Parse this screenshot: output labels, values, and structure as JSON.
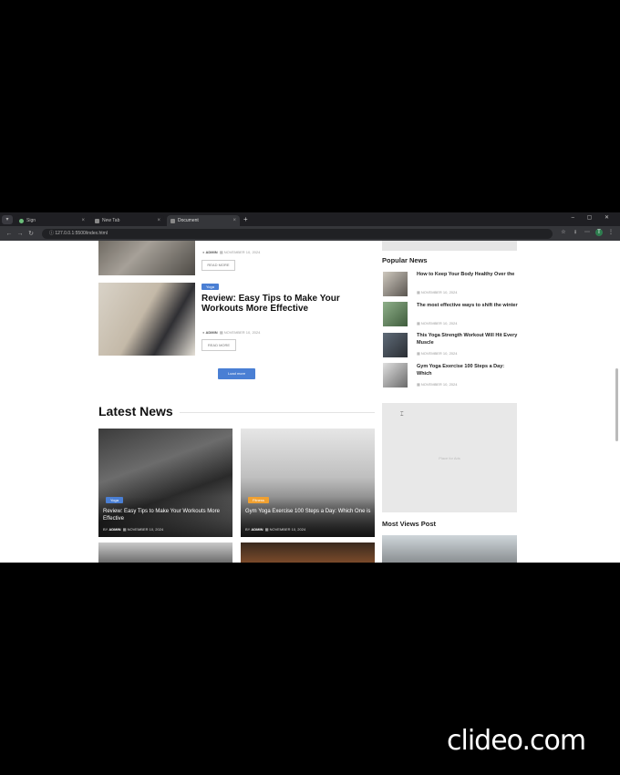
{
  "browser": {
    "tabs": [
      {
        "label": "Sign",
        "active": false
      },
      {
        "label": "New Tab",
        "active": false
      },
      {
        "label": "Document",
        "active": true
      }
    ],
    "url": "127.0.0.1:5500/index.html",
    "new_tab": "+",
    "window_controls": "– ▢ ✕",
    "menu": "▾",
    "nav_back": "←",
    "nav_forward": "→",
    "nav_reload": "↻",
    "url_icon": "ⓘ",
    "star_icon": "☆",
    "download_icon": "⭳",
    "extensions_icon": "⋯",
    "profile_initial": "T",
    "more_icon": "⋮",
    "tab_close": "×"
  },
  "featured": [
    {
      "category": "",
      "title": "",
      "author": "ADMIN",
      "date": "NOVEMBER 10, 2024",
      "button": "READ MORE"
    },
    {
      "category": "Yoga",
      "title": "Review: Easy Tips to Make Your Workouts More Effective",
      "author": "ADMIN",
      "date": "NOVEMBER 10, 2024",
      "button": "READ MORE"
    }
  ],
  "load_more": "Load more",
  "latest_news": {
    "heading": "Latest News",
    "cards": [
      {
        "category": "Yoga",
        "title": "Review: Easy Tips to Make Your Workouts More Effective",
        "by": "BY",
        "author": "ADMIN",
        "date": "NOVEMBER 10, 2024"
      },
      {
        "category": "Fitness",
        "title": "Gym Yoga Exercise 100 Steps a Day: Which One is",
        "by": "BY",
        "author": "ADMIN",
        "date": "NOVEMBER 10, 2024"
      }
    ]
  },
  "sidebar": {
    "popular_heading": "Popular News",
    "popular": [
      {
        "title": "How to Keep Your Body Healthy Over the",
        "date": "NOVEMBER 10, 2024"
      },
      {
        "title": "The most effective ways to shift the winter",
        "date": "NOVEMBER 10, 2024"
      },
      {
        "title": "This Yoga Strength Workout Will Hit Every Muscle",
        "date": "NOVEMBER 10, 2024"
      },
      {
        "title": "Gym Yoga Exercise 100 Steps a Day: Which",
        "date": "NOVEMBER 10, 2024"
      }
    ],
    "ad_label": "Place for Ads",
    "most_views_heading": "Most Views Post"
  },
  "watermark": "clideo.com",
  "colors": {
    "accent": "#4a7fd4",
    "fitness_badge": "#f0a030"
  }
}
